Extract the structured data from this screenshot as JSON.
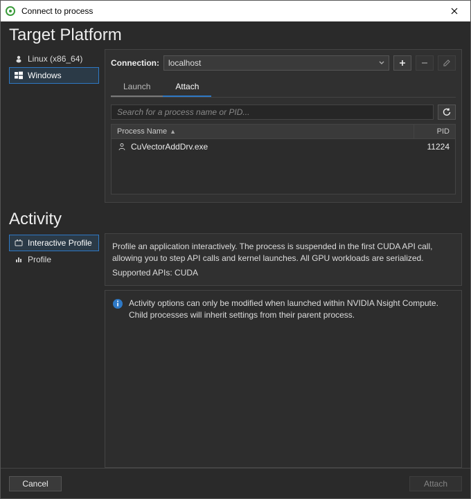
{
  "window": {
    "title": "Connect to process"
  },
  "target_platform": {
    "heading": "Target Platform",
    "items": [
      {
        "label": "Linux (x86_64)",
        "icon": "linux-icon",
        "selected": false
      },
      {
        "label": "Windows",
        "icon": "windows-icon",
        "selected": true
      }
    ]
  },
  "connection": {
    "label": "Connection:",
    "value": "localhost",
    "tabs": [
      {
        "label": "Launch",
        "active": false
      },
      {
        "label": "Attach",
        "active": true
      }
    ],
    "search_placeholder": "Search for a process name or PID...",
    "columns": {
      "name": "Process Name",
      "pid": "PID"
    },
    "rows": [
      {
        "name": "CuVectorAddDrv.exe",
        "pid": "11224"
      }
    ]
  },
  "activity": {
    "heading": "Activity",
    "items": [
      {
        "label": "Interactive Profile",
        "selected": true
      },
      {
        "label": "Profile",
        "selected": false
      }
    ],
    "description": "Profile an application interactively. The process is suspended in the first CUDA API call, allowing you to step API calls and kernel launches. All GPU workloads are serialized.",
    "supported": "Supported APIs: CUDA",
    "info": "Activity options can only be modified when launched within NVIDIA Nsight Compute. Child processes will inherit settings from their parent process."
  },
  "footer": {
    "cancel": "Cancel",
    "attach": "Attach"
  }
}
